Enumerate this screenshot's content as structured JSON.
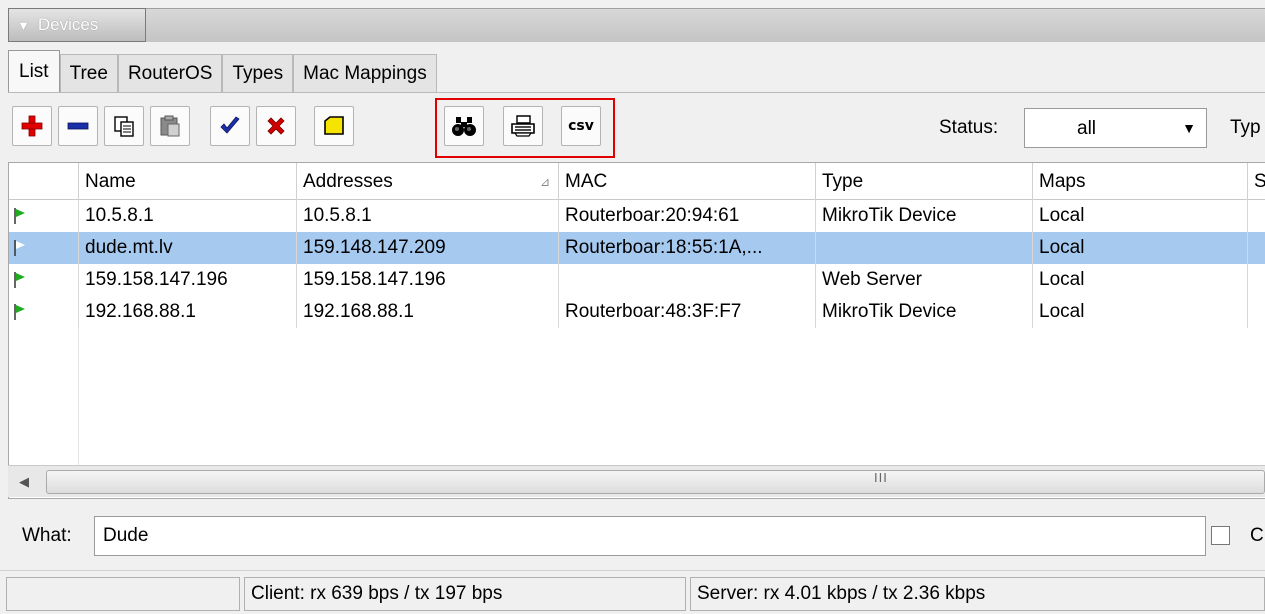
{
  "window": {
    "title": "Devices"
  },
  "tabs": [
    "List",
    "Tree",
    "RouterOS",
    "Types",
    "Mac Mappings"
  ],
  "toolbar": {
    "buttons": [
      "add-icon",
      "remove-icon",
      "copy-icon",
      "paste-icon",
      "enable-icon",
      "disable-icon",
      "comment-icon",
      "find-icon",
      "print-icon",
      "csv-icon"
    ],
    "csv_label": "csv",
    "status_label": "Status:",
    "status_value": "all",
    "type_label": "Typ"
  },
  "table": {
    "columns": [
      "Name",
      "Addresses",
      "MAC",
      "Type",
      "Maps",
      "S"
    ],
    "rows": [
      {
        "flag": "green",
        "name": "10.5.8.1",
        "addresses": "10.5.8.1",
        "mac": "Routerboar:20:94:61",
        "type": "MikroTik Device",
        "maps": "Local"
      },
      {
        "flag": "white",
        "name": "dude.mt.lv",
        "addresses": "159.148.147.209",
        "mac": "Routerboar:18:55:1A,...",
        "type": "",
        "maps": "Local"
      },
      {
        "flag": "green",
        "name": "159.158.147.196",
        "addresses": "159.158.147.196",
        "mac": "",
        "type": "Web Server",
        "maps": "Local"
      },
      {
        "flag": "green",
        "name": "192.168.88.1",
        "addresses": "192.168.88.1",
        "mac": "Routerboar:48:3F:F7",
        "type": "MikroTik Device",
        "maps": "Local"
      }
    ],
    "scroll_grip": "III"
  },
  "what": {
    "label": "What:",
    "value": "Dude",
    "check_label": "C"
  },
  "statusbar": {
    "client": "Client: rx 639 bps / tx 197 bps",
    "server": "Server: rx 4.01 kbps / tx 2.36 kbps"
  },
  "colors": {
    "selected_row": "#a6c9f0",
    "highlight": "#e00000",
    "flag_green": "#22aa22"
  }
}
